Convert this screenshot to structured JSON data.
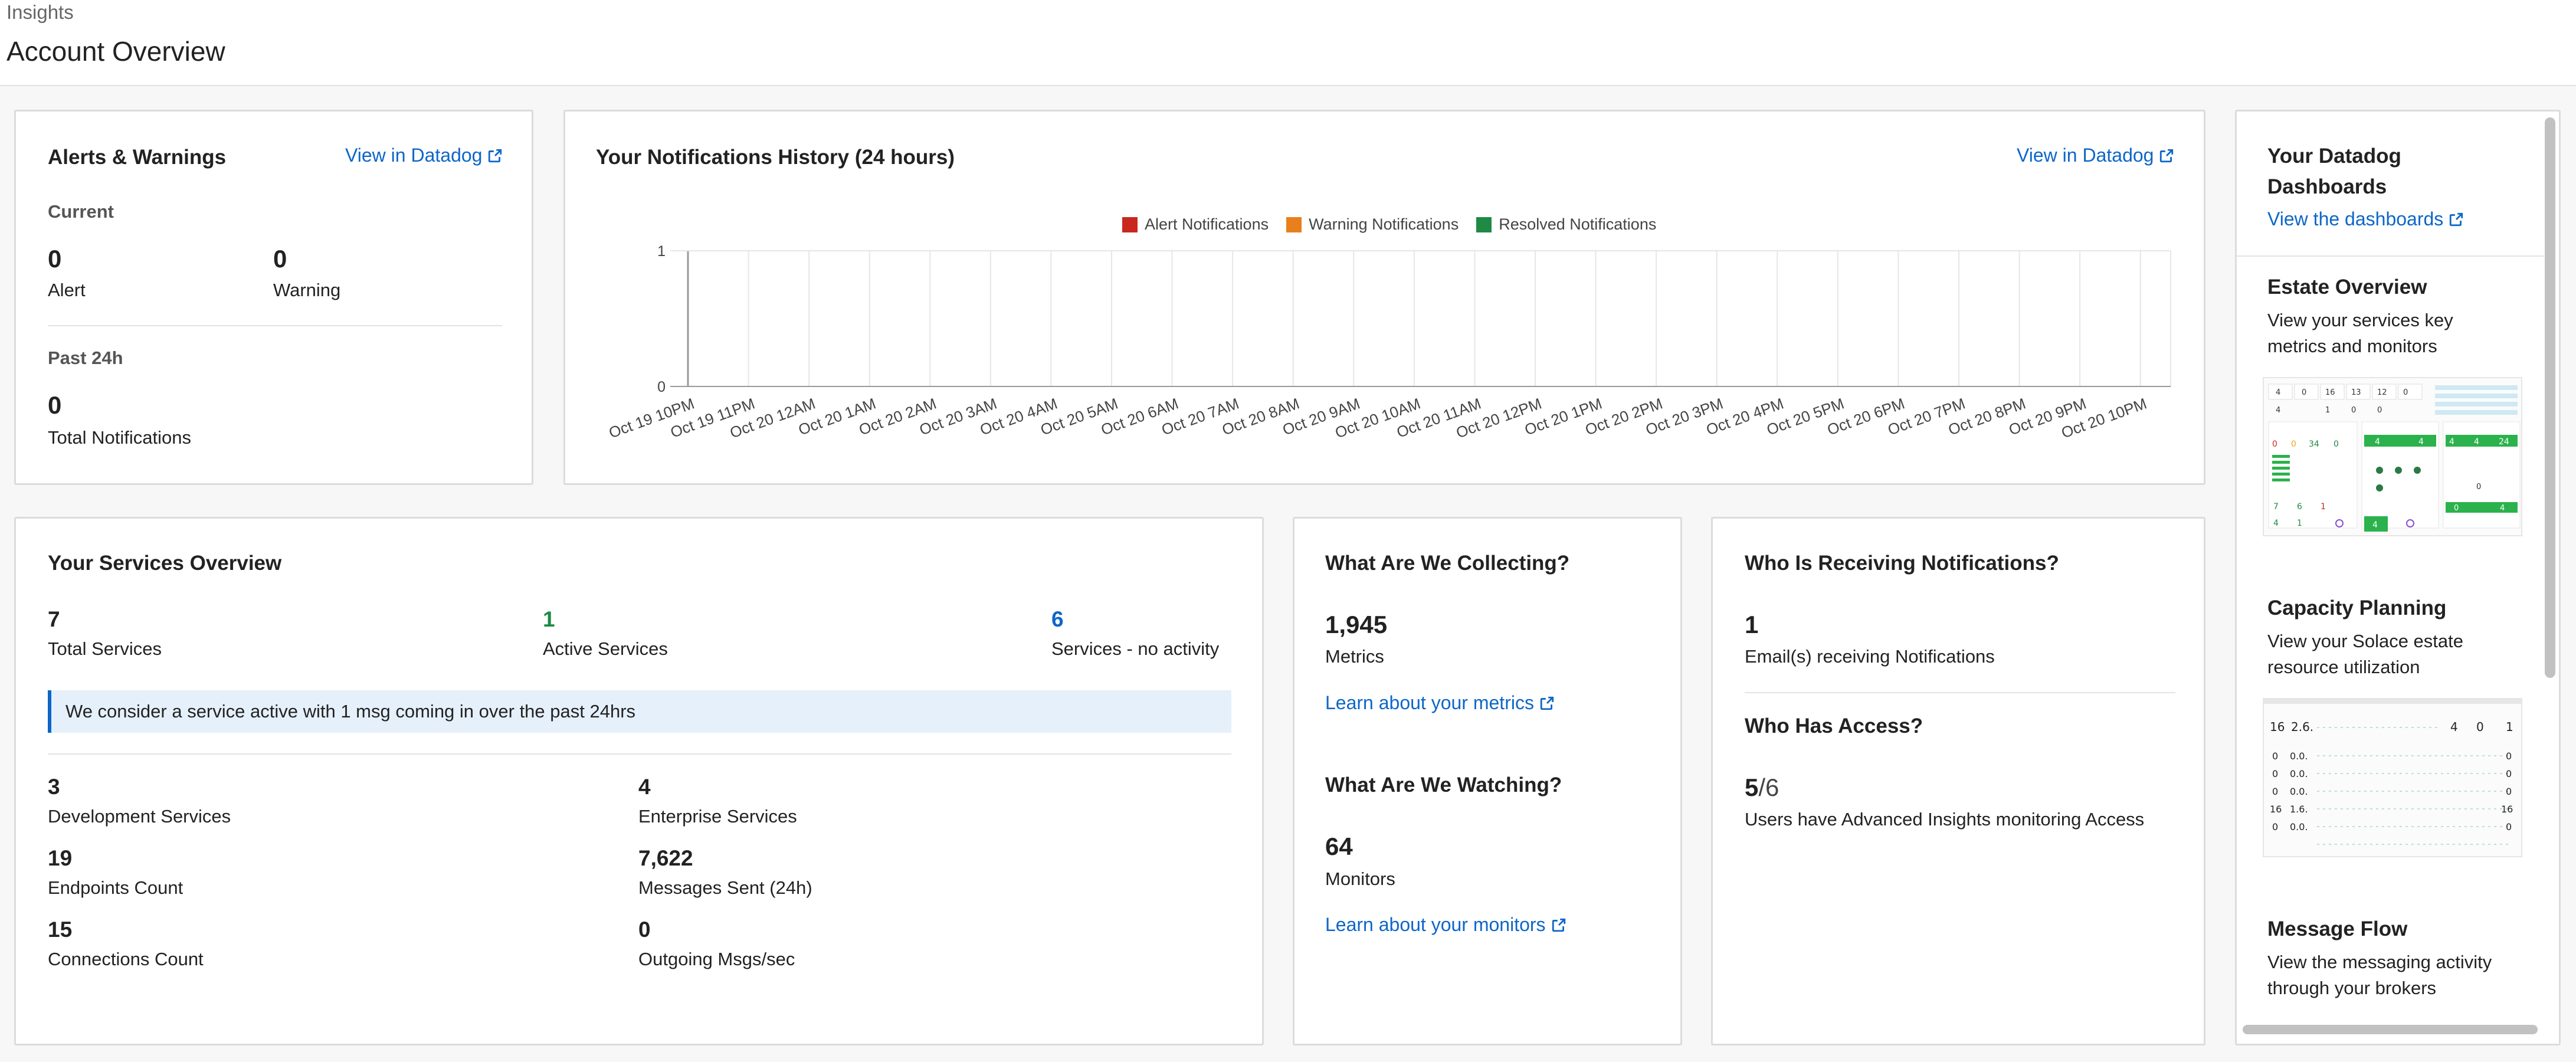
{
  "header": {
    "breadcrumb": "Insights",
    "title": "Account Overview"
  },
  "alerts": {
    "title": "Alerts & Warnings",
    "link": "View in Datadog",
    "current_label": "Current",
    "alert_value": "0",
    "alert_label": "Alert",
    "warning_value": "0",
    "warning_label": "Warning",
    "past_label": "Past 24h",
    "total_value": "0",
    "total_label": "Total Notifications"
  },
  "history": {
    "title": "Your Notifications History (24 hours)",
    "link": "View in Datadog"
  },
  "chart_data": {
    "type": "bar",
    "title": "",
    "series": [
      {
        "name": "Alert Notifications",
        "color": "#c8281e",
        "values": [
          0,
          0,
          0,
          0,
          0,
          0,
          0,
          0,
          0,
          0,
          0,
          0,
          0,
          0,
          0,
          0,
          0,
          0,
          0,
          0,
          0,
          0,
          0,
          0,
          0
        ]
      },
      {
        "name": "Warning Notifications",
        "color": "#e87f1c",
        "values": [
          0,
          0,
          0,
          0,
          0,
          0,
          0,
          0,
          0,
          0,
          0,
          0,
          0,
          0,
          0,
          0,
          0,
          0,
          0,
          0,
          0,
          0,
          0,
          0,
          0
        ]
      },
      {
        "name": "Resolved Notifications",
        "color": "#1e8a43",
        "values": [
          0,
          0,
          0,
          0,
          0,
          0,
          0,
          0,
          0,
          0,
          0,
          0,
          0,
          0,
          0,
          0,
          0,
          0,
          0,
          0,
          0,
          0,
          0,
          0,
          0
        ]
      }
    ],
    "categories": [
      "Oct 19 10PM",
      "Oct 19 11PM",
      "Oct 20 12AM",
      "Oct 20 1AM",
      "Oct 20 2AM",
      "Oct 20 3AM",
      "Oct 20 4AM",
      "Oct 20 5AM",
      "Oct 20 6AM",
      "Oct 20 7AM",
      "Oct 20 8AM",
      "Oct 20 9AM",
      "Oct 20 10AM",
      "Oct 20 11AM",
      "Oct 20 12PM",
      "Oct 20 1PM",
      "Oct 20 2PM",
      "Oct 20 3PM",
      "Oct 20 4PM",
      "Oct 20 5PM",
      "Oct 20 6PM",
      "Oct 20 7PM",
      "Oct 20 8PM",
      "Oct 20 9PM",
      "Oct 20 10PM"
    ],
    "ylim": [
      0,
      1
    ],
    "yticks": [
      "0",
      "1"
    ],
    "grid": true,
    "legend": "top"
  },
  "services": {
    "title": "Your Services Overview",
    "total_value": "7",
    "total_label": "Total Services",
    "active_value": "1",
    "active_label": "Active Services",
    "noact_value": "6",
    "noact_label": "Services - no activity",
    "info": "We consider a service active with 1 msg coming in over the past 24hrs",
    "dev_value": "3",
    "dev_label": "Development Services",
    "ent_value": "4",
    "ent_label": "Enterprise Services",
    "endpoints_value": "19",
    "endpoints_label": "Endpoints Count",
    "messages_value": "7,622",
    "messages_label": "Messages Sent (24h)",
    "conn_value": "15",
    "conn_label": "Connections Count",
    "out_value": "0",
    "out_label": "Outgoing Msgs/sec",
    "active_color": "#1e8a43",
    "noact_color": "#0d66c8"
  },
  "collecting": {
    "title": "What Are We Collecting?",
    "metrics_value": "1,945",
    "metrics_label": "Metrics",
    "metrics_link": "Learn about your metrics",
    "watch_title": "What Are We Watching?",
    "monitors_value": "64",
    "monitors_label": "Monitors",
    "monitors_link": "Learn about your monitors"
  },
  "receiving": {
    "title": "Who Is Receiving Notifications?",
    "emails_value": "1",
    "emails_label": "Email(s) receiving Notifications",
    "access_title": "Who Has Access?",
    "access_value_main": "5",
    "access_value_rest": "/6",
    "access_label": "Users have Advanced Insights monitoring Access"
  },
  "dashboards": {
    "title_line1": "Your Datadog",
    "title_line2": "Dashboards",
    "link": "View the dashboards",
    "items": [
      {
        "title": "Estate Overview",
        "desc1": "View your services key",
        "desc2": "metrics and monitors"
      },
      {
        "title": "Capacity Planning",
        "desc1": "View your Solace estate",
        "desc2": "resource utilization"
      },
      {
        "title": "Message Flow",
        "desc1": "View the messaging activity",
        "desc2": "through your brokers"
      }
    ]
  }
}
